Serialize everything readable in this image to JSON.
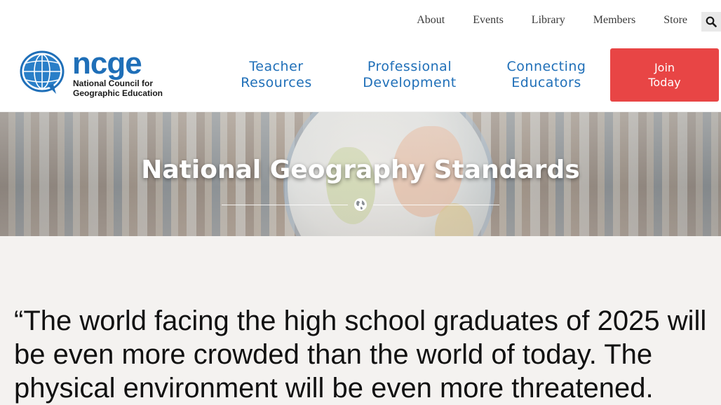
{
  "topnav": {
    "items": [
      "About",
      "Events",
      "Library",
      "Members",
      "Store"
    ]
  },
  "logo": {
    "wordmark": "ncge",
    "subtitle": "National Council for Geographic Education"
  },
  "mainnav": {
    "items": [
      {
        "line1": "Teacher",
        "line2": "Resources"
      },
      {
        "line1": "Professional",
        "line2": "Development"
      },
      {
        "line1": "Connecting",
        "line2": "Educators"
      }
    ],
    "join_line1": "Join",
    "join_line2": "Today"
  },
  "hero": {
    "title": "National Geography Standards"
  },
  "quote": {
    "text": "“The world facing the high school graduates of 2025 will be even more crowded than the world of today. The physical environment will be even more threatened."
  },
  "colors": {
    "brand_blue": "#1f6fb8",
    "join_red": "#e84545",
    "page_bg": "#f4f2f0"
  },
  "icons": [
    "search-icon",
    "globe-logo-icon",
    "globe-icon"
  ]
}
